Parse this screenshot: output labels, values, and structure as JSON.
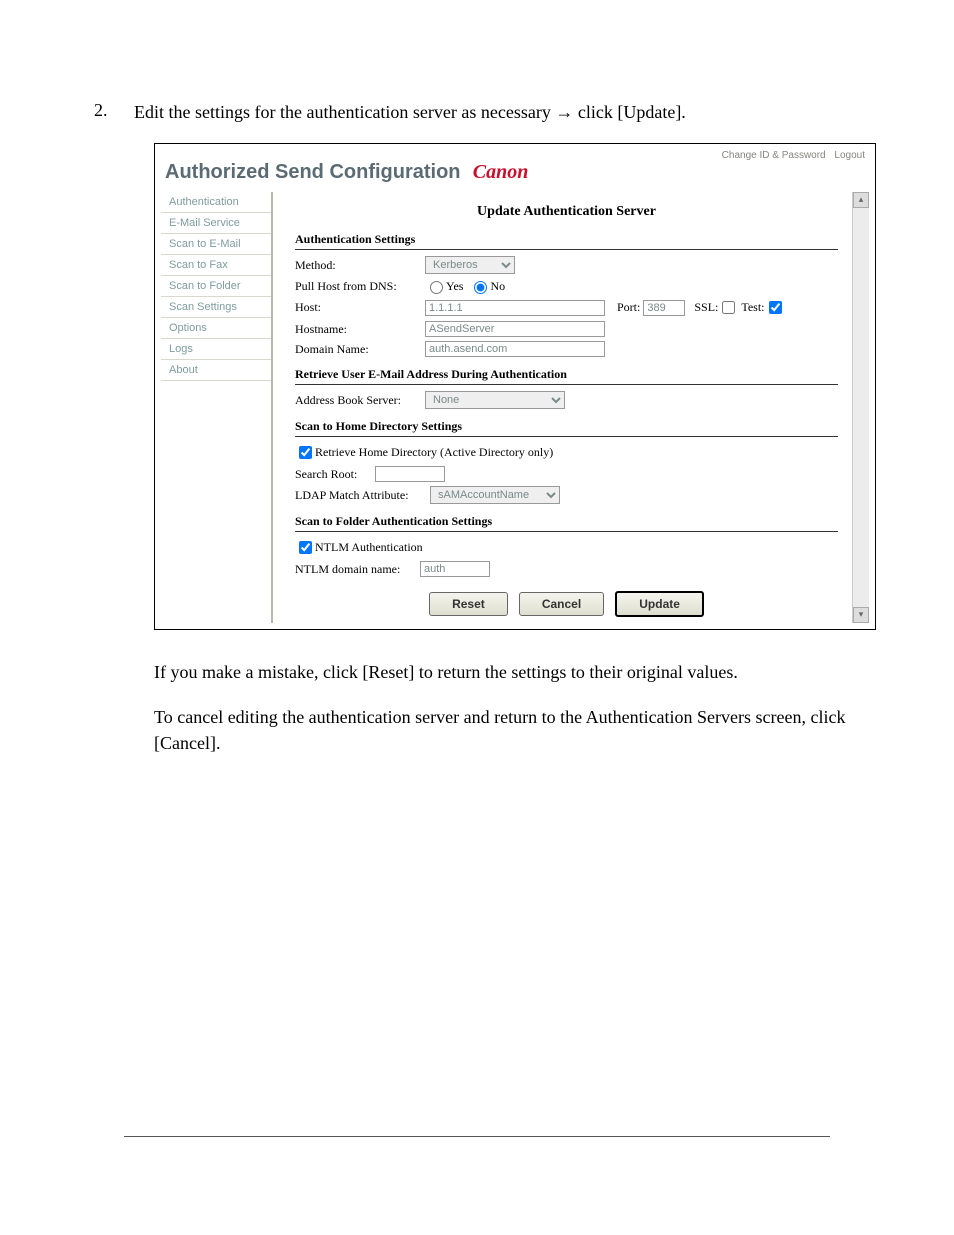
{
  "step": {
    "number": "2.",
    "text_a": "Edit the settings for the authentication server as necessary ",
    "arrow": "→",
    "text_b": " click [Update]."
  },
  "screenshot": {
    "toplinks": {
      "change": "Change ID & Password",
      "logout": "Logout"
    },
    "title_a": "Authorized Send Configuration",
    "title_b": "Canon",
    "sidebar": [
      "Authentication",
      "E-Mail Service",
      "Scan to E-Mail",
      "Scan to Fax",
      "Scan to Folder",
      "Scan Settings",
      "Options",
      "Logs",
      "About"
    ],
    "heading": "Update Authentication Server",
    "section_auth": "Authentication Settings",
    "method_label": "Method:",
    "method_value": "Kerberos",
    "dns_label": "Pull Host from DNS:",
    "dns_yes": "Yes",
    "dns_no": "No",
    "dns_selected": "No",
    "host_label": "Host:",
    "host_value": "1.1.1.1",
    "port_label": "Port:",
    "port_value": "389",
    "ssl_label": "SSL:",
    "ssl_checked": false,
    "test_label": "Test:",
    "test_checked": true,
    "hostname_label": "Hostname:",
    "hostname_value": "ASendServer",
    "domain_label": "Domain Name:",
    "domain_value": "auth.asend.com",
    "section_email": "Retrieve User E-Mail Address During Authentication",
    "abs_label": "Address Book Server:",
    "abs_value": "None",
    "section_home": "Scan to Home Directory Settings",
    "home_chk_label": "Retrieve Home Directory (Active Directory only)",
    "home_chk": true,
    "searchroot_label": "Search Root:",
    "searchroot_value": "",
    "ldap_label": "LDAP Match Attribute:",
    "ldap_value": "sAMAccountName",
    "section_folder": "Scan to Folder Authentication Settings",
    "ntlm_chk": true,
    "ntlm_label": "NTLM Authentication",
    "ntlm_domain_label": "NTLM domain name:",
    "ntlm_domain_value": "auth",
    "buttons": {
      "reset": "Reset",
      "cancel": "Cancel",
      "update": "Update"
    }
  },
  "para1": "If you make a mistake, click [Reset] to return the settings to their original values.",
  "para2": "To cancel editing the authentication server and return to the Authentication Servers screen, click [Cancel]."
}
